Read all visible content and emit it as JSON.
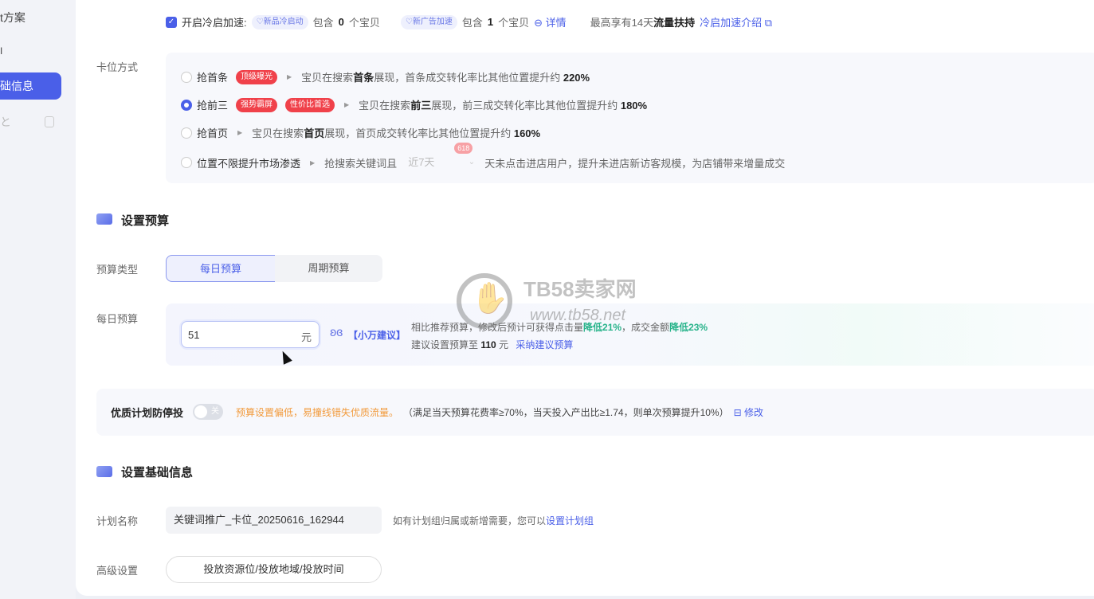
{
  "sidebar": {
    "items": [
      {
        "label": "t方案"
      },
      {
        "label": "I"
      },
      {
        "label": "础信息"
      },
      {
        "label": "と"
      }
    ]
  },
  "cold_start": {
    "checkbox_label": "开启冷启加速:",
    "tag1": "新品冷启动",
    "text1a": "包含",
    "count1": "0",
    "text1b": "个宝贝",
    "tag2": "新广告加速",
    "text2a": "包含",
    "count2": "1",
    "text2b": "个宝贝",
    "details": "详情",
    "support_a": "最高享有14天",
    "support_b": "流量扶持",
    "intro_link": "冷启加速介绍"
  },
  "slot": {
    "label": "卡位方式",
    "options": [
      {
        "title": "抢首条",
        "tags": [
          "顶级曝光"
        ],
        "desc_a": "宝贝在搜索",
        "desc_b": "首条",
        "desc_c": "展现，首条成交转化率比其他位置提升约",
        "pct": "220%"
      },
      {
        "title": "抢前三",
        "tags": [
          "强势霸屏",
          "性价比首选"
        ],
        "desc_a": "宝贝在搜索",
        "desc_b": "前三",
        "desc_c": "展现，前三成交转化率比其他位置提升约",
        "pct": "180%"
      },
      {
        "title": "抢首页",
        "desc_a": "宝贝在搜索",
        "desc_b": "首页",
        "desc_c": "展现，首页成交转化率比其他位置提升约",
        "pct": "160%"
      }
    ],
    "option4": {
      "title": "位置不限提升市场渗透",
      "desc_a": "抢搜索关键词且",
      "select": "近7天",
      "badge": "618",
      "desc_b": "天未点击进店用户，提升未进店新访客规模，为店铺带来增量成交"
    }
  },
  "budget": {
    "section_title": "设置预算",
    "type_label": "预算类型",
    "type_daily": "每日预算",
    "type_period": "周期预算",
    "daily_label": "每日预算",
    "amount": "51",
    "unit": "元",
    "advice_tag": "【小万建议】",
    "advice_line1a": "相比推荐预算，修改后预计可获得点击量",
    "advice_line1b": "降低21%",
    "advice_line1c": "，成交金额",
    "advice_line1d": "降低23%",
    "advice_line2a": "建议设置预算至",
    "advice_amount": "110",
    "advice_line2b": "元",
    "adopt_link": "采纳建议预算"
  },
  "guard": {
    "label": "优质计划防停投",
    "toggle_text": "关",
    "warn": "预算设置偏低，易撞线错失优质流量。",
    "rule": "（满足当天预算花费率≥70%，当天投入产出比≥1.74，则单次预算提升10%）",
    "edit": "修改"
  },
  "basic": {
    "section_title": "设置基础信息",
    "name_label": "计划名称",
    "name_value": "关键词推广_卡位_20250616_162944",
    "name_hint": "如有计划组归属或新增需要，您可以",
    "name_link": "设置计划组",
    "adv_label": "高级设置",
    "adv_button": "投放资源位/投放地域/投放时间"
  },
  "watermark": {
    "title": "TB58卖家网",
    "url": "www.tb58.net"
  }
}
